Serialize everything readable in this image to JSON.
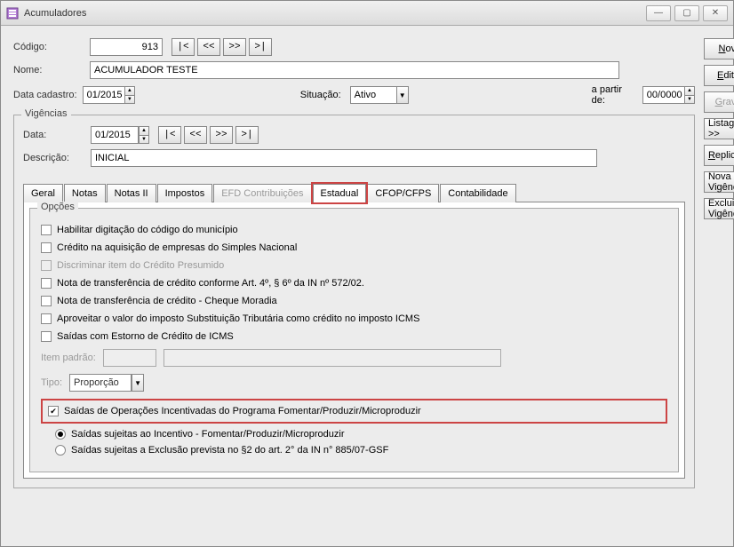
{
  "window": {
    "title": "Acumuladores"
  },
  "labels": {
    "codigo": "Código:",
    "nome": "Nome:",
    "data_cadastro": "Data cadastro:",
    "situacao": "Situação:",
    "a_partir_de": "a partir de:",
    "data": "Data:",
    "descricao": "Descrição:",
    "item_padrao": "Item padrão:",
    "tipo": "Tipo:"
  },
  "values": {
    "codigo": "913",
    "nome": "ACUMULADOR TESTE",
    "data_cadastro": "01/2015",
    "situacao": "Ativo",
    "a_partir_de": "00/0000",
    "vig_data": "01/2015",
    "vig_descricao": "INICIAL",
    "tipo": "Proporção"
  },
  "nav": {
    "first": "|<",
    "prev": "<<",
    "next": ">>",
    "last": ">|"
  },
  "fieldsets": {
    "vigencias": "Vigências",
    "opcoes": "Opções"
  },
  "tabs": [
    {
      "id": "geral",
      "label": "Geral"
    },
    {
      "id": "notas",
      "label": "Notas"
    },
    {
      "id": "notas2",
      "label": "Notas II"
    },
    {
      "id": "impostos",
      "label": "Impostos"
    },
    {
      "id": "efd",
      "label": "EFD Contribuições",
      "disabled": true
    },
    {
      "id": "estadual",
      "label": "Estadual",
      "active": true,
      "highlight": true
    },
    {
      "id": "cfop",
      "label": "CFOP/CFPS"
    },
    {
      "id": "contab",
      "label": "Contabilidade"
    }
  ],
  "options": {
    "habilitar_municipio": "Habilitar digitação do código do município",
    "credito_simples": "Crédito na aquisição de empresas do Simples Nacional",
    "discriminar_presumido": "Discriminar item do Crédito Presumido",
    "nota_transf_art4": "Nota de transferência de crédito conforme Art. 4º, § 6º da IN nº 572/02.",
    "nota_transf_cheque": "Nota de transferência de crédito - Cheque Moradia",
    "aproveitar_st": "Aproveitar o valor do imposto Substituição Tributária como crédito no imposto ICMS",
    "saidas_estorno": "Saídas com Estorno de Crédito de ICMS",
    "saidas_incentivadas": "Saídas de Operações Incentivadas do Programa Fomentar/Produzir/Microproduzir",
    "radio_incentivo": "Saídas sujeitas ao Incentivo - Fomentar/Produzir/Microproduzir",
    "radio_exclusao": "Saídas sujeitas a Exclusão prevista no §2 do art. 2° da IN n° 885/07-GSF"
  },
  "buttons": {
    "novo": "Novo",
    "editar": "Editar",
    "gravar": "Gravar",
    "listagem": "Listagem >>",
    "replicar": "Replicar...",
    "nova_vigencia": "Nova Vigência",
    "excluir_vigencia": "Excluir Vigência"
  },
  "win_buttons": {
    "min": "—",
    "max": "▢",
    "close": "✕"
  }
}
